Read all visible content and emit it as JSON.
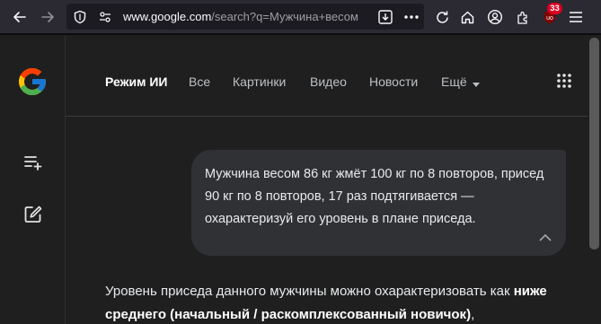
{
  "browser": {
    "url_host": "www.google.com",
    "url_rest": "/search?q=Мужчина+весом",
    "notification_count": "33"
  },
  "nav": {
    "tabs": [
      {
        "label": "Режим ИИ",
        "active": true
      },
      {
        "label": "Все"
      },
      {
        "label": "Картинки"
      },
      {
        "label": "Видео"
      },
      {
        "label": "Новости"
      },
      {
        "label": "Ещё"
      }
    ]
  },
  "query": {
    "text": "Мужчина весом 86 кг жмёт 100 кг по 8 повторов, присед 90 кг по 8 повторов, 17 раз подтягивается — охарактеризуй его уровень в плане приседа."
  },
  "answer": {
    "intro": "Уровень приседа данного мужчины можно охарактеризовать как ",
    "bold": "ниже среднего (начальный / раскомплексованный новичок)",
    "tail": ","
  },
  "colors": {
    "background": "#1f1f1f",
    "toolbar": "#2b2a33",
    "bubble": "#303134",
    "badge": "#d70022"
  },
  "icons": {
    "back": "back-arrow-icon",
    "forward": "forward-arrow-icon",
    "shield": "shield-icon",
    "permissions": "permissions-icon",
    "download": "download-icon",
    "more": "more-icon",
    "reload": "reload-icon",
    "home": "home-icon",
    "account": "account-icon",
    "extensions": "extensions-icon",
    "ublock": "ublock-icon",
    "menu": "hamburger-menu-icon",
    "google": "google-logo-icon",
    "history": "history-icon",
    "new_chat": "new-chat-icon",
    "apps": "apps-grid-icon",
    "collapse": "chevron-up-icon"
  }
}
